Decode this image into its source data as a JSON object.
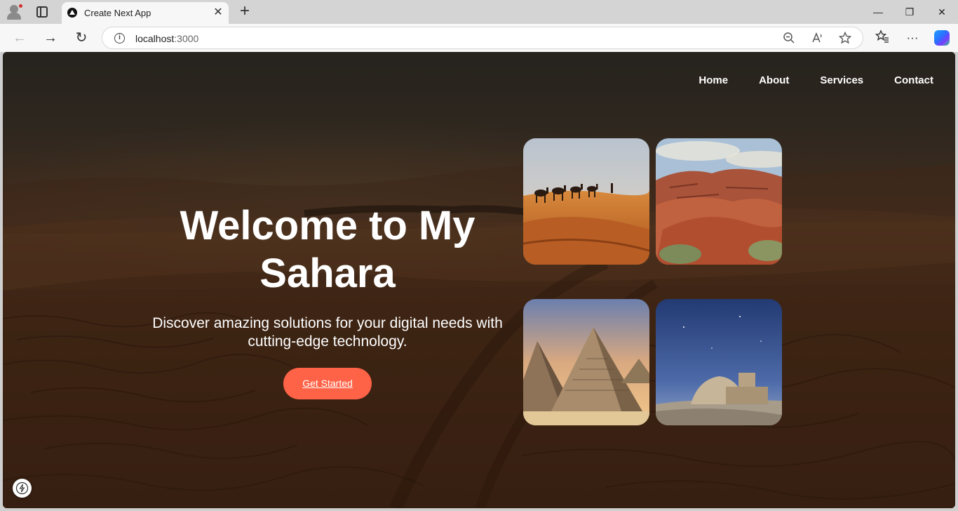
{
  "browser": {
    "tab_title": "Create Next App",
    "tab_close_glyph": "✕",
    "new_tab_glyph": "+",
    "url_host": "localhost",
    "url_port": ":3000",
    "window_controls": {
      "minimize": "—",
      "restore": "❐",
      "close": "✕"
    },
    "nav": {
      "back": "←",
      "forward": "→",
      "reload": "↻"
    },
    "icons": [
      "profile-icon",
      "tab-actions-icon",
      "site-info-icon",
      "zoom-out-icon",
      "read-aloud-icon",
      "favorite-star-icon",
      "favorites-icon",
      "more-options-icon",
      "copilot-icon"
    ]
  },
  "page": {
    "nav_links": [
      "Home",
      "About",
      "Services",
      "Contact"
    ],
    "hero": {
      "title_line1": "Welcome to My",
      "title_line2": "Sahara",
      "subtitle": "Discover amazing solutions for your digital needs with cutting-edge technology.",
      "cta_label": "Get Started"
    },
    "gallery": [
      "camel-caravan-image",
      "red-rock-canyon-image",
      "pyramids-image",
      "desert-night-ruins-image"
    ],
    "colors": {
      "accent": "#ff6347",
      "text": "#ffffff"
    }
  }
}
